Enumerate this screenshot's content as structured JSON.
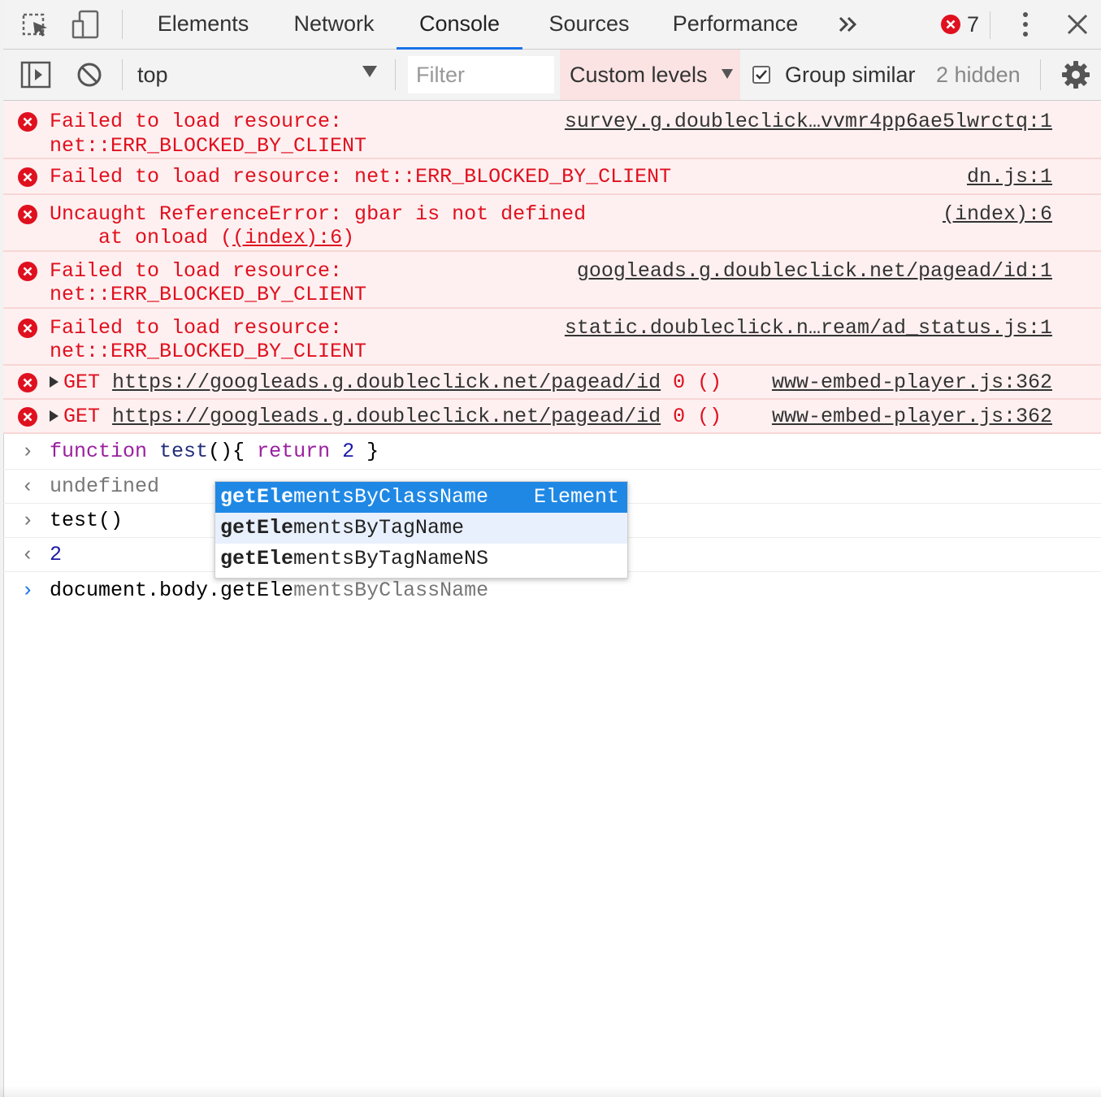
{
  "tabs": [
    "Elements",
    "Network",
    "Console",
    "Sources",
    "Performance"
  ],
  "active_tab": "Console",
  "error_badge": {
    "count": "7"
  },
  "toolbar": {
    "context": "top",
    "filter_placeholder": "Filter",
    "levels": "Custom levels",
    "group_similar": "Group similar",
    "group_similar_checked": true,
    "hidden": "2 hidden"
  },
  "errors": [
    {
      "line1": "Failed to load resource:",
      "line2": "net::ERR_BLOCKED_BY_CLIENT",
      "source": "survey.g.doubleclick…vvmr4pp6ae5lwrctq:1"
    },
    {
      "line1": "Failed to load resource: net::ERR_BLOCKED_BY_CLIENT",
      "source": "dn.js:1"
    },
    {
      "line1": "Uncaught ReferenceError: gbar is not defined",
      "line2_prefix": "    at onload (",
      "line2_link": "(index):6",
      "line2_suffix": ")",
      "source": "(index):6"
    },
    {
      "line1": "Failed to load resource:",
      "line2": "net::ERR_BLOCKED_BY_CLIENT",
      "source": "googleads.g.doubleclick.net/pagead/id:1"
    },
    {
      "line1": "Failed to load resource:",
      "line2": "net::ERR_BLOCKED_BY_CLIENT",
      "source": "static.doubleclick.n…ream/ad_status.js:1"
    },
    {
      "method": "GET",
      "url": "https://googleads.g.doubleclick.net/pagead/id",
      "status": "0 ()",
      "source": "www-embed-player.js:362"
    },
    {
      "method": "GET",
      "url": "https://googleads.g.doubleclick.net/pagead/id",
      "status": "0 ()",
      "source": "www-embed-player.js:362"
    }
  ],
  "logs": [
    {
      "kw1": "function",
      "name": " test",
      "rest": "(){ ",
      "kw2": "return",
      "num": " 2",
      "end": " }"
    },
    {
      "result": "undefined"
    },
    {
      "input": "test()"
    },
    {
      "result": "2"
    }
  ],
  "prompt": {
    "typed": "document.body.getEle",
    "ghost": "mentsByClassName"
  },
  "autocomplete": [
    {
      "match": "getEle",
      "rest": "mentsByClassName",
      "type": "Element"
    },
    {
      "match": "getEle",
      "rest": "mentsByTagName"
    },
    {
      "match": "getEle",
      "rest": "mentsByTagNameNS"
    }
  ],
  "colors": {
    "error_bg": "#fef0f0",
    "error_text": "#e0101f",
    "accent": "#1a73e8",
    "selection": "#1f88e5"
  }
}
